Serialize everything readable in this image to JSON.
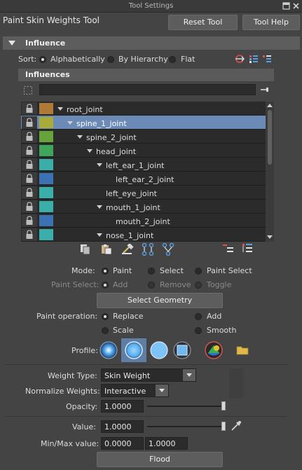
{
  "window": {
    "title": "Tool Settings"
  },
  "tool": {
    "title": "Paint Skin Weights Tool",
    "reset_label": "Reset Tool",
    "help_label": "Tool Help"
  },
  "influence_section": {
    "title": "Influence",
    "sort_label": "Sort:",
    "sort_options": [
      "Alphabetically",
      "By Hierarchy",
      "Flat"
    ],
    "sort_selected": "Alphabetically",
    "influences_header": "Influences",
    "filter_value": ""
  },
  "joints": [
    {
      "name": "root_joint",
      "color": "#b07a36",
      "depth": 0,
      "expandable": true,
      "selected": false
    },
    {
      "name": "spine_1_joint",
      "color": "#a8ab3a",
      "depth": 1,
      "expandable": true,
      "selected": true
    },
    {
      "name": "spine_2_joint",
      "color": "#67a23a",
      "depth": 2,
      "expandable": true,
      "selected": false
    },
    {
      "name": "head_joint",
      "color": "#3fa55a",
      "depth": 3,
      "expandable": true,
      "selected": false
    },
    {
      "name": "left_ear_1_joint",
      "color": "#3aaea8",
      "depth": 4,
      "expandable": true,
      "selected": false
    },
    {
      "name": "left_ear_2_joint",
      "color": "#3b72b4",
      "depth": 5,
      "expandable": false,
      "selected": false
    },
    {
      "name": "left_eye_joint",
      "color": "#3aaea8",
      "depth": 4,
      "expandable": false,
      "selected": false
    },
    {
      "name": "mouth_1_joint",
      "color": "#3aaea8",
      "depth": 4,
      "expandable": true,
      "selected": false
    },
    {
      "name": "mouth_2_joint",
      "color": "#3b72b4",
      "depth": 5,
      "expandable": false,
      "selected": false
    },
    {
      "name": "nose_1_joint",
      "color": "#3aaea8",
      "depth": 4,
      "expandable": true,
      "selected": false
    }
  ],
  "mode": {
    "label": "Mode:",
    "options": [
      "Paint",
      "Select",
      "Paint Select"
    ],
    "selected": "Paint",
    "paint_select_label": "Paint Select:",
    "paint_select_options": [
      "Add",
      "Remove",
      "Toggle"
    ],
    "select_geometry_label": "Select Geometry"
  },
  "paint_operation": {
    "label": "Paint operation:",
    "options": [
      "Replace",
      "Add",
      "Scale",
      "Smooth"
    ],
    "selected": "Replace"
  },
  "profile": {
    "label": "Profile:",
    "selected_index": 1
  },
  "weights": {
    "weight_type_label": "Weight Type:",
    "weight_type_value": "Skin Weight",
    "normalize_label": "Normalize Weights:",
    "normalize_value": "Interactive",
    "opacity_label": "Opacity:",
    "opacity_value": "1.0000",
    "opacity_fraction": 1.0
  },
  "value_section": {
    "value_label": "Value:",
    "value": "1.0000",
    "value_fraction": 1.0,
    "minmax_label": "Min/Max value:",
    "min_value": "0.0000",
    "max_value": "1.0000",
    "flood_label": "Flood"
  },
  "colors": {
    "accent": "#6b8ab5",
    "panel": "#444444",
    "header": "#5d5d5d"
  }
}
